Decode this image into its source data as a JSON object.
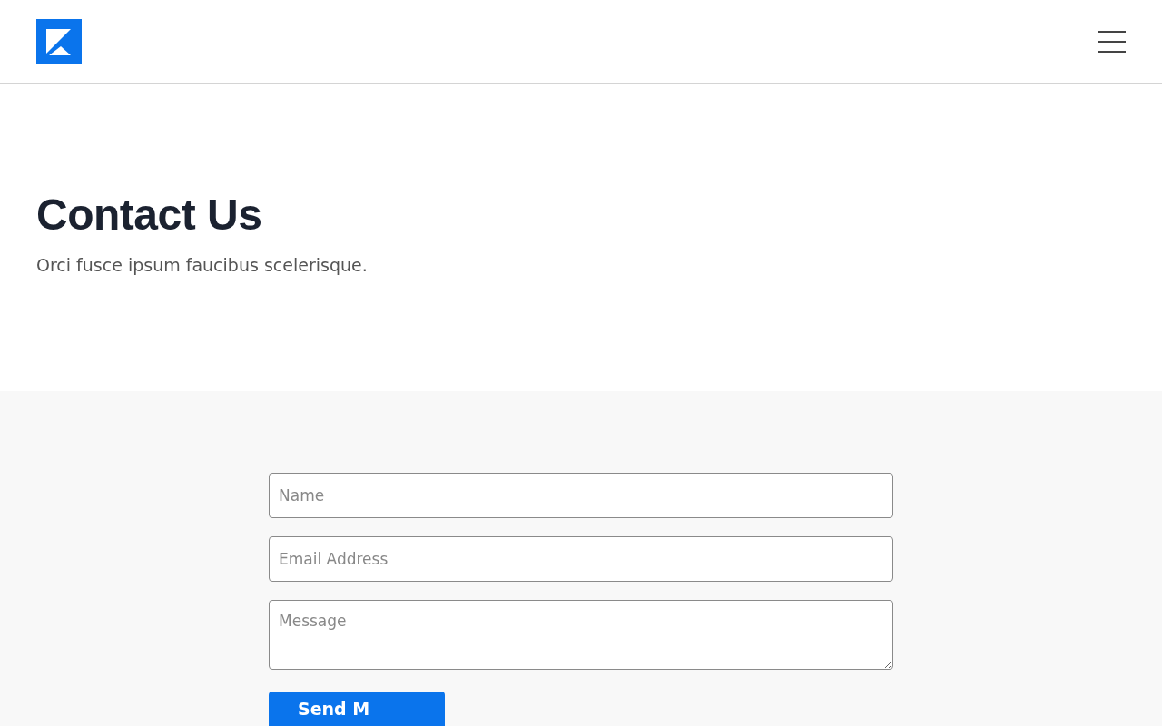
{
  "hero": {
    "title": "Contact Us",
    "subtitle": "Orci fusce ipsum faucibus scelerisque."
  },
  "form": {
    "fields": [
      {
        "kind": "input",
        "placeholder": "Name"
      },
      {
        "kind": "input",
        "placeholder": "Email Address"
      },
      {
        "kind": "textarea",
        "placeholder": "Message"
      }
    ],
    "submit": "Send M"
  }
}
